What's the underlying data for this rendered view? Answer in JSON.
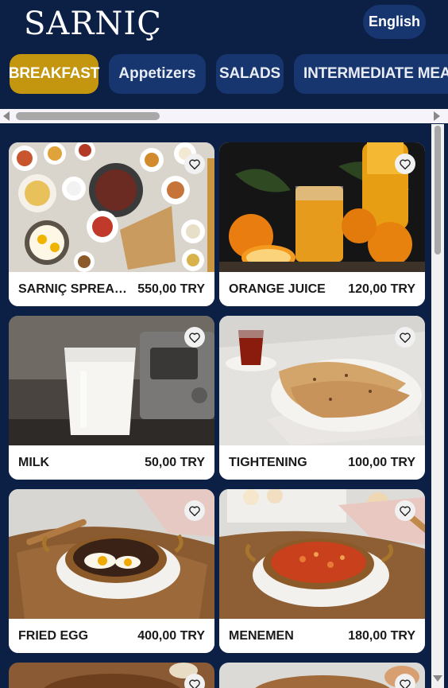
{
  "header": {
    "logo": "SARNIÇ",
    "language_label": "English"
  },
  "tabs": [
    {
      "label": "BREAKFAST",
      "active": true
    },
    {
      "label": "Appetizers",
      "active": false
    },
    {
      "label": "SALADS",
      "active": false
    },
    {
      "label": "INTERMEDIATE MEALS",
      "active": false
    }
  ],
  "products": [
    {
      "name": "SARNIÇ SPREAD BR...",
      "price": "550,00 TRY",
      "image": "breakfast-spread-photo"
    },
    {
      "name": "ORANGE JUICE",
      "price": "120,00 TRY",
      "image": "orange-juice-photo"
    },
    {
      "name": "MILK",
      "price": "50,00 TRY",
      "image": "milk-glass-photo"
    },
    {
      "name": "TIGHTENING",
      "price": "100,00 TRY",
      "image": "flatbread-tea-photo"
    },
    {
      "name": "FRIED EGG",
      "price": "400,00 TRY",
      "image": "fried-egg-pan-photo"
    },
    {
      "name": "MENEMEN",
      "price": "180,00 TRY",
      "image": "menemen-pan-photo"
    }
  ],
  "colors": {
    "background": "#0c1f45",
    "tab": "#17356e",
    "tab_active": "#c4960f"
  }
}
